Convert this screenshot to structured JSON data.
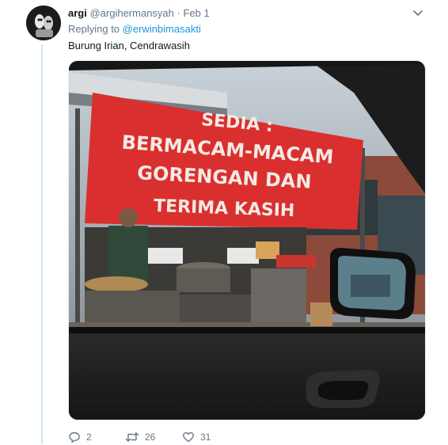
{
  "tweet": {
    "display_name": "argi",
    "handle": "@argihermansyah",
    "separator": "·",
    "date": "Feb 1",
    "replying_prefix": "Replying to",
    "replying_to": "@erwinbimasakti",
    "text": "Burung Irian, Cendrawasih"
  },
  "media": {
    "banner_lines": [
      "SEDIA :",
      "BERMACAM-MACAM",
      "GORENGAN DAN",
      "TERIMA KASIH"
    ],
    "banner_color": "#d9302f"
  },
  "actions": {
    "replies": "2",
    "retweets": "26",
    "likes": "31"
  },
  "colors": {
    "link": "#1b95e0",
    "muted": "#657786",
    "thread_line": "#cfe6f5"
  }
}
